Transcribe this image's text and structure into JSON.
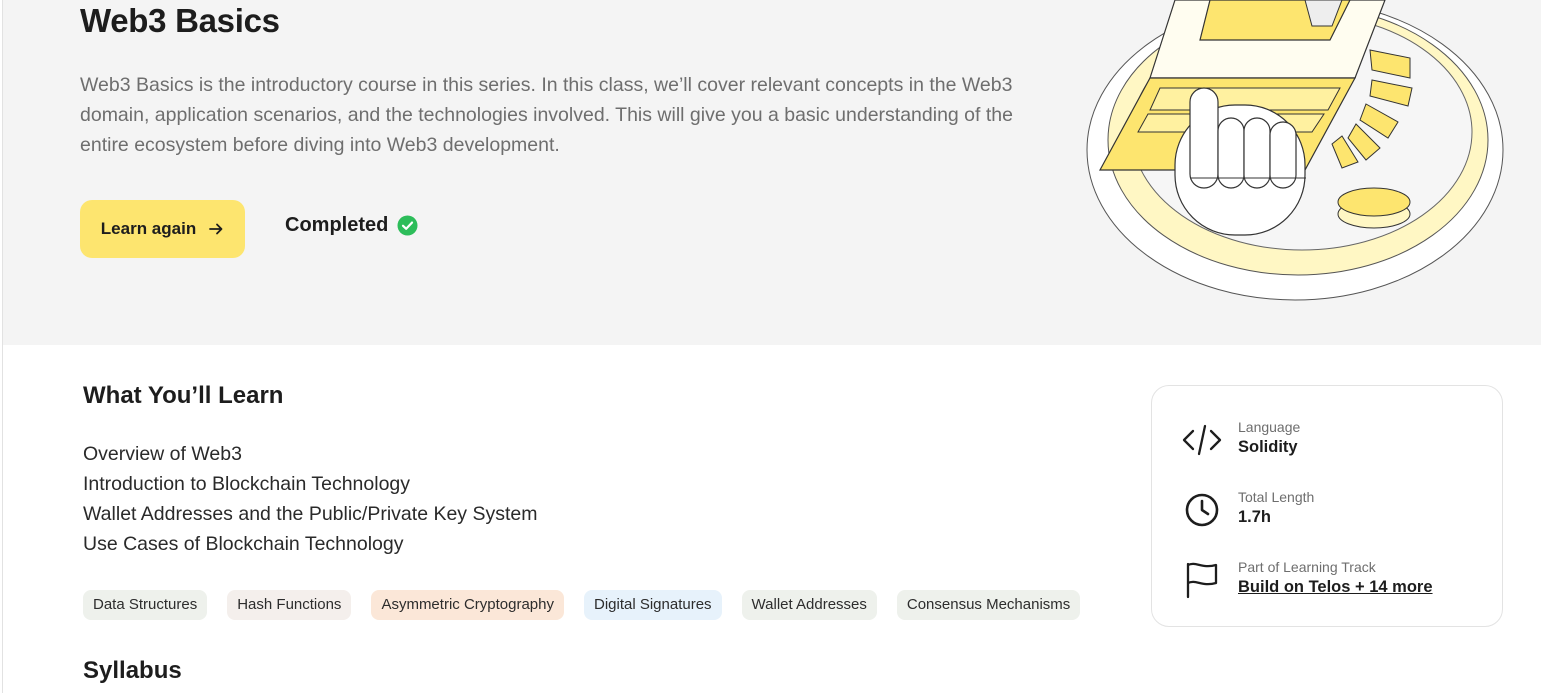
{
  "course": {
    "title": "Web3 Basics",
    "description": "Web3 Basics is the introductory course in this series. In this class, we’ll cover relevant concepts in the Web3 domain, application scenarios, and the technologies involved. This will give you a basic understanding of the entire ecosystem before diving into Web3 development.",
    "primary_button_label": "Learn again",
    "status_label": "Completed"
  },
  "learn": {
    "title": "What You’ll Learn",
    "items": [
      "Overview of Web3",
      "Introduction to Blockchain Technology",
      "Wallet Addresses and the Public/Private Key System",
      "Use Cases of Blockchain Technology"
    ],
    "tags": [
      {
        "label": "Data Structures",
        "color": "#eef1ec"
      },
      {
        "label": "Hash Functions",
        "color": "#f4efec"
      },
      {
        "label": "Asymmetric Cryptography",
        "color": "#fbe7d8"
      },
      {
        "label": "Digital Signatures",
        "color": "#e7f2fb"
      },
      {
        "label": "Wallet Addresses",
        "color": "#eef1ec"
      },
      {
        "label": "Consensus Mechanisms",
        "color": "#eef1ec"
      }
    ]
  },
  "info": {
    "language_label": "Language",
    "language_value": "Solidity",
    "length_label": "Total Length",
    "length_value": "1.7h",
    "track_label": "Part of Learning Track",
    "track_value": "Build on Telos + 14 more"
  },
  "syllabus": {
    "title": "Syllabus"
  },
  "colors": {
    "accent": "#fde56f",
    "success": "#2dbd5a",
    "hero_bg": "#f4f4f4"
  }
}
